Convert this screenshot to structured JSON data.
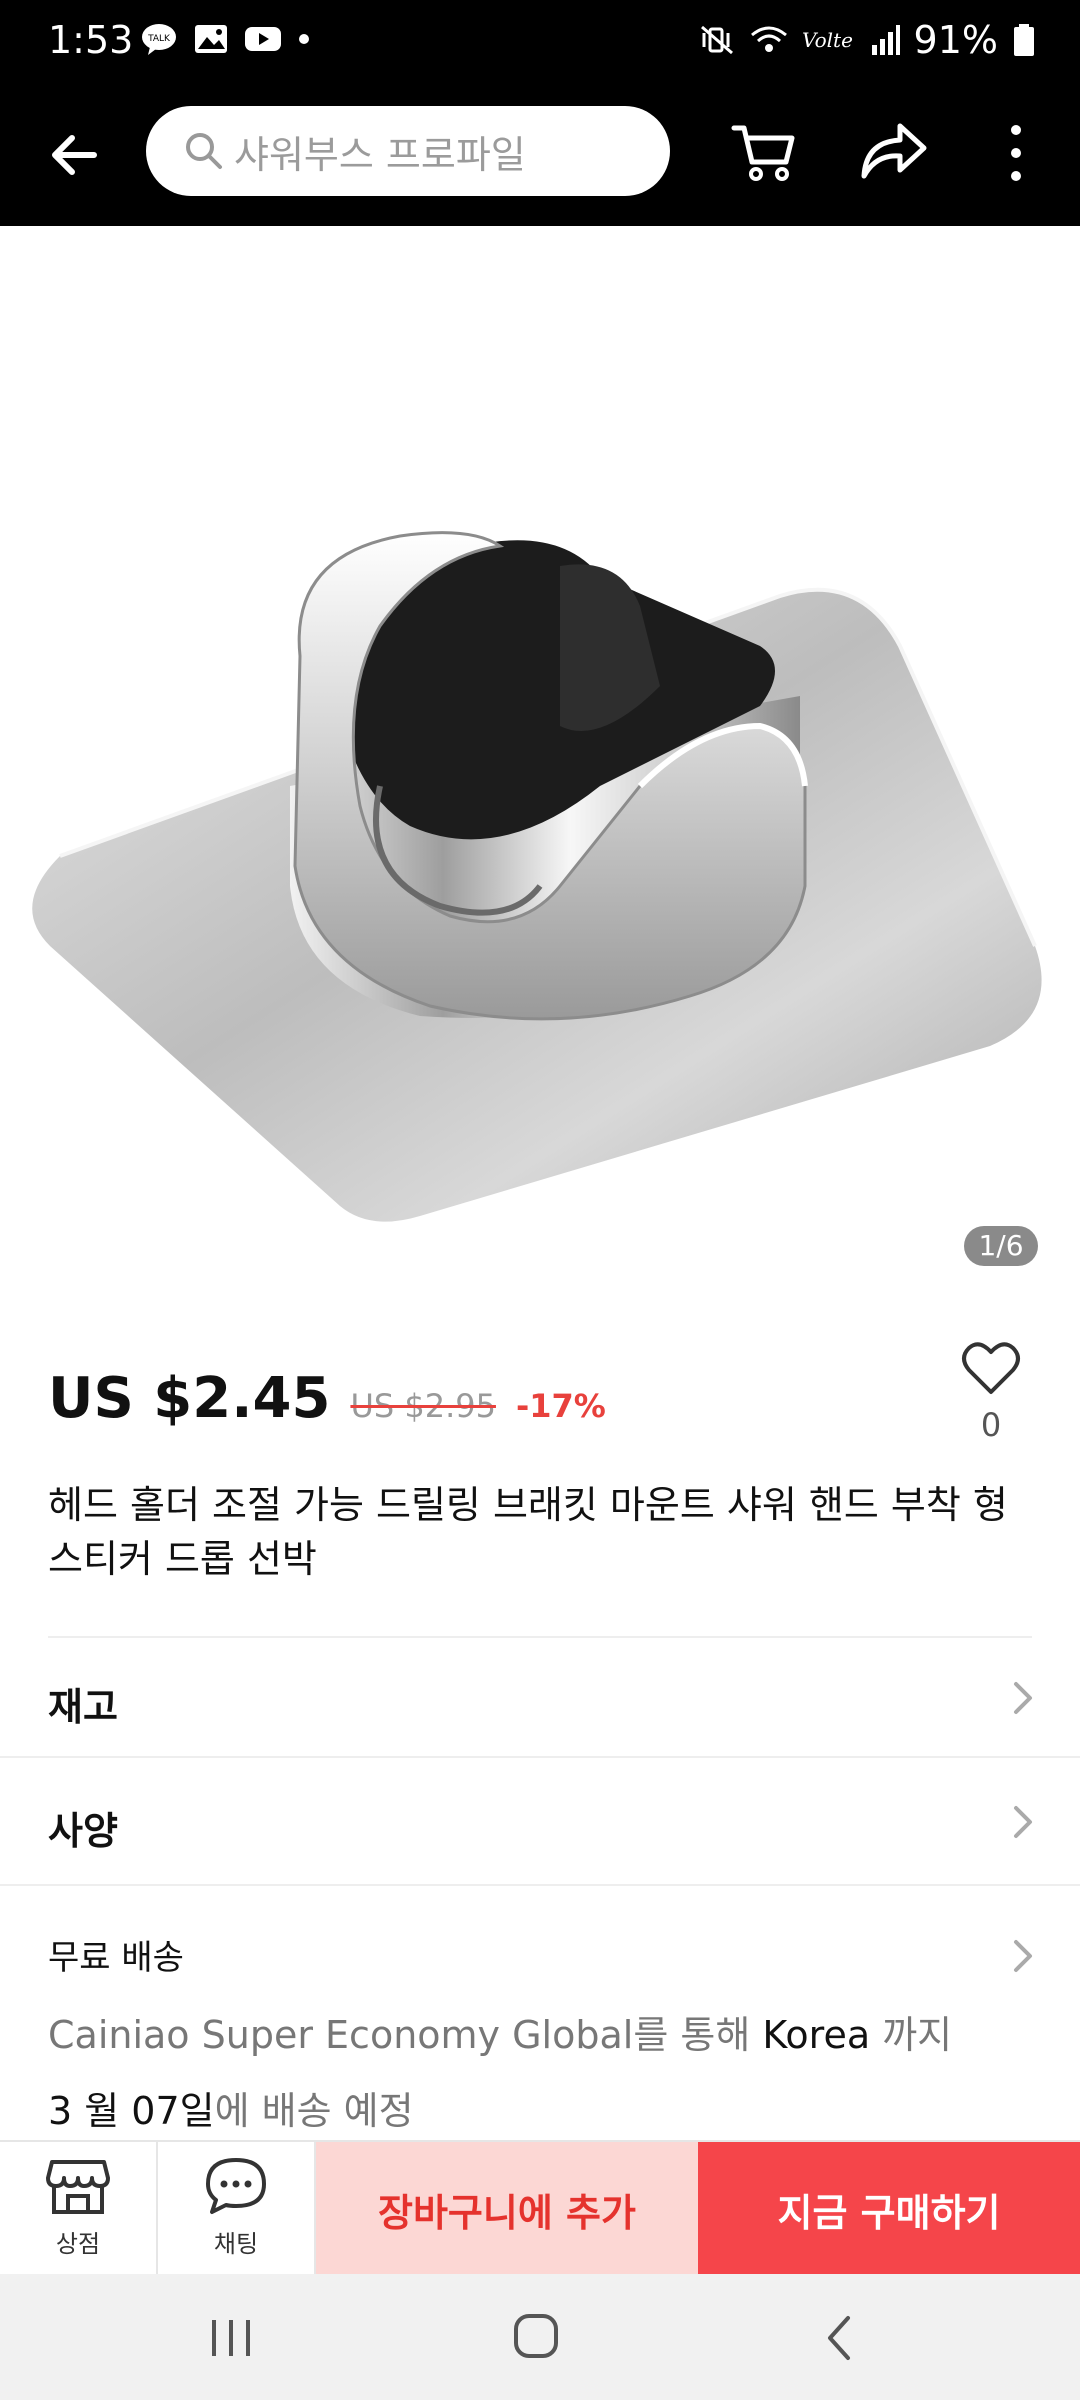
{
  "status_bar": {
    "time": "1:53",
    "battery": "91%",
    "icons": [
      "talk-icon",
      "gallery-icon",
      "youtube-icon",
      "dot-icon",
      "mute-vibrate-icon",
      "wifi-icon",
      "volte-icon",
      "signal-icon",
      "battery-icon"
    ]
  },
  "top_nav": {
    "search_placeholder": "샤워부스 프로파일",
    "icons": [
      "back-arrow-icon",
      "search-icon",
      "cart-icon",
      "share-icon",
      "more-vertical-icon"
    ]
  },
  "gallery": {
    "counter": "1/6"
  },
  "product": {
    "price": "US $2.45",
    "original_price": "US $2.95",
    "discount": "-17%",
    "wishlist_count": "0",
    "title": "헤드 홀더 조절 가능 드릴링 브래킷 마운트 샤워 핸드 부착 형 스티커 드롭 선박"
  },
  "rows": {
    "stock": "재고",
    "specs": "사양"
  },
  "shipping": {
    "label": "무료 배송",
    "carrier": "Cainiao Super Economy Global",
    "via_text": "를 통해 ",
    "destination": "Korea",
    "to_text": " 까지",
    "date": "3 월 07일",
    "date_suffix": "에 배송 예정"
  },
  "action_bar": {
    "store_label": "상점",
    "chat_label": "채팅",
    "add_to_cart": "장바구니에 추가",
    "buy_now": "지금 구매하기"
  },
  "colors": {
    "accent_red": "#e8413c",
    "buy_button": "#f5454a",
    "cart_button_bg": "#fcd7d4",
    "header_bg": "#000000"
  }
}
